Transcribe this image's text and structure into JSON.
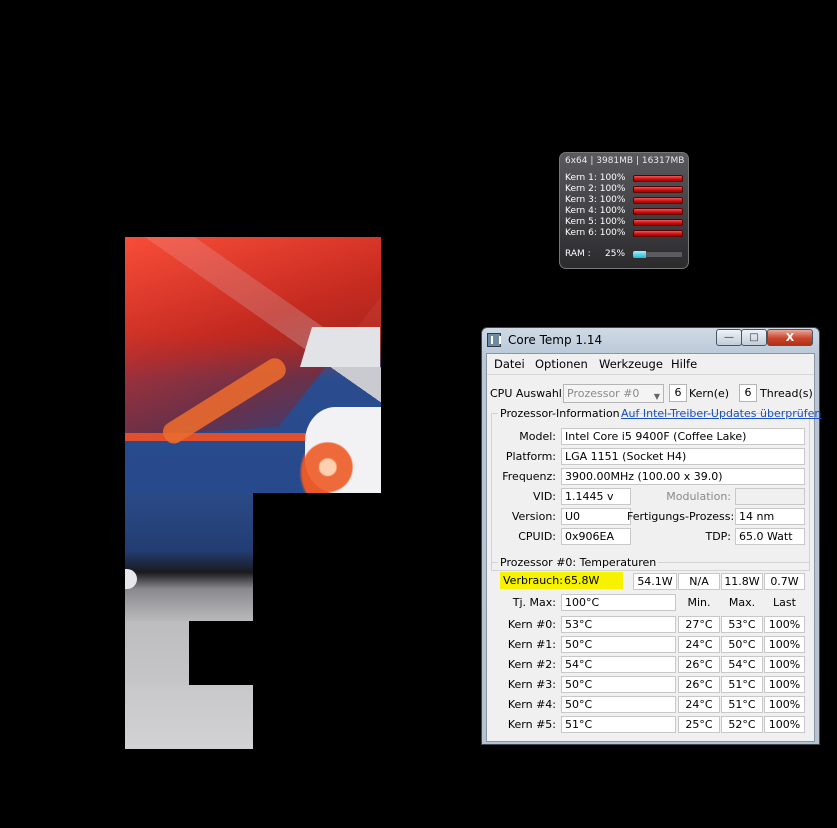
{
  "gadget": {
    "title": "6x64 | 3981MB | 16317MB",
    "cores": [
      {
        "label": "Kern 1:",
        "value": "100%",
        "percent": 100
      },
      {
        "label": "Kern 2:",
        "value": "100%",
        "percent": 100
      },
      {
        "label": "Kern 3:",
        "value": "100%",
        "percent": 100
      },
      {
        "label": "Kern 4:",
        "value": "100%",
        "percent": 100
      },
      {
        "label": "Kern 5:",
        "value": "100%",
        "percent": 100
      },
      {
        "label": "Kern 6:",
        "value": "100%",
        "percent": 100
      }
    ],
    "ram": {
      "label": "RAM :",
      "value": "25%",
      "percent": 25
    }
  },
  "window": {
    "title": "Core Temp 1.14",
    "controls": {
      "minimize": "—",
      "maximize": "□",
      "close": "X"
    }
  },
  "menu": [
    "Datei",
    "Optionen",
    "Werkzeuge",
    "Hilfe"
  ],
  "cpu_select": {
    "label": "CPU Auswahl:",
    "processor": "Prozessor #0",
    "cores_value": "6",
    "cores_label": "Kern(e)",
    "threads_value": "6",
    "threads_label": "Thread(s)"
  },
  "proc_info": {
    "heading": "Prozessor-Information",
    "link": "Auf Intel-Treiber-Updates überprüfen",
    "model_label": "Model:",
    "model": "Intel Core i5 9400F (Coffee Lake)",
    "platform_label": "Platform:",
    "platform": "LGA 1151 (Socket H4)",
    "frequency_label": "Frequenz:",
    "frequency": "3900.00MHz (100.00 x 39.0)",
    "vid_label": "VID:",
    "vid": "1.1445 v",
    "modulation_label": "Modulation:",
    "modulation": "",
    "version_label": "Version:",
    "version": "U0",
    "process_label": "Fertigungs-Prozess:",
    "process": "14 nm",
    "cpuid_label": "CPUID:",
    "cpuid": "0x906EA",
    "tdp_label": "TDP:",
    "tdp": "65.0 Watt"
  },
  "temps": {
    "heading": "Prozessor #0: Temperaturen",
    "power_label": "Verbrauch:",
    "power": "65.8W",
    "power_values": [
      "54.1W",
      "N/A",
      "11.8W",
      "0.7W"
    ],
    "tjmax_label": "Tj. Max:",
    "tjmax": "100°C",
    "col_headers": [
      "Min.",
      "Max.",
      "Last"
    ],
    "cores": [
      {
        "label": "Kern #0:",
        "temp": "53°C",
        "min": "27°C",
        "max": "53°C",
        "load": "100%"
      },
      {
        "label": "Kern #1:",
        "temp": "50°C",
        "min": "24°C",
        "max": "50°C",
        "load": "100%"
      },
      {
        "label": "Kern #2:",
        "temp": "54°C",
        "min": "26°C",
        "max": "54°C",
        "load": "100%"
      },
      {
        "label": "Kern #3:",
        "temp": "50°C",
        "min": "26°C",
        "max": "51°C",
        "load": "100%"
      },
      {
        "label": "Kern #4:",
        "temp": "50°C",
        "min": "24°C",
        "max": "51°C",
        "load": "100%"
      },
      {
        "label": "Kern #5:",
        "temp": "51°C",
        "min": "25°C",
        "max": "52°C",
        "load": "100%"
      }
    ]
  }
}
